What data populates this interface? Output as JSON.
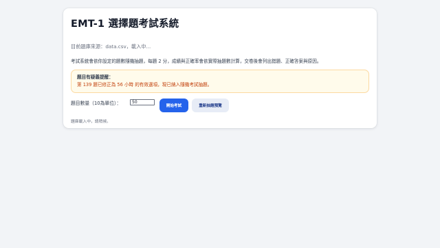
{
  "app": {
    "title": "EMT-1 選擇題考試系統"
  },
  "source": {
    "text": "目前題庫來源：data.csv，載入中..."
  },
  "description": {
    "text": "考試系統會依你設定的題數隨機抽題，每題 2 分，成績與正確率會依實際抽題數計算，交卷後會列出錯題、正確答案與原因。"
  },
  "alert": {
    "title": "題目有疑義提醒：",
    "message": "第 139 題已修正為 56 小時 的有效選項，現已納入隨機考試抽題。"
  },
  "controls": {
    "count_label": "題目數量（10為單位）：",
    "count_value": "50",
    "start_label": "開始考試",
    "reshuffle_label": "重新抽題預覽"
  },
  "status": {
    "text": "題庫載入中，請稍候。"
  },
  "colors": {
    "primary": "#2563eb",
    "alert_background": "#fffbeb",
    "alert_border": "#fcd9a0",
    "alert_text": "#c2410c"
  }
}
